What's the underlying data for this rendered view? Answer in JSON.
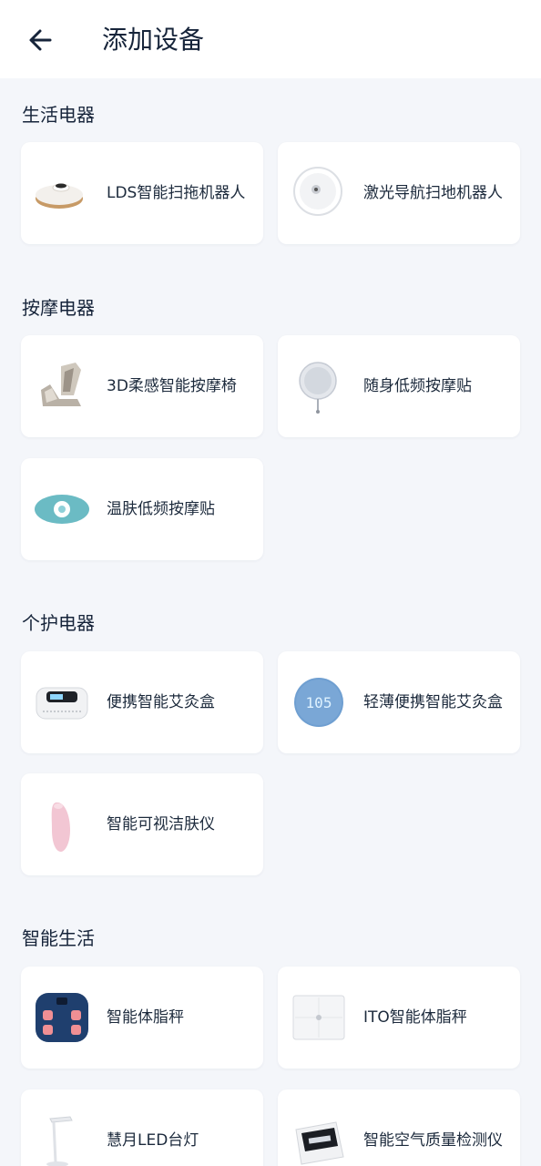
{
  "header": {
    "title": "添加设备",
    "back_icon": "arrow-left-icon"
  },
  "sections": [
    {
      "title": "生活电器",
      "devices": [
        {
          "label": "LDS智能扫拖机器人",
          "icon": "robot-vacuum-icon"
        },
        {
          "label": "激光导航扫地机器人",
          "icon": "robot-vacuum-white-icon"
        }
      ]
    },
    {
      "title": "按摩电器",
      "devices": [
        {
          "label": "3D柔感智能按摩椅",
          "icon": "massage-chair-icon"
        },
        {
          "label": "随身低频按摩贴",
          "icon": "massage-pad-round-icon"
        },
        {
          "label": "温肤低频按摩贴",
          "icon": "massage-pad-oval-icon"
        }
      ]
    },
    {
      "title": "个护电器",
      "devices": [
        {
          "label": "便携智能艾灸盒",
          "icon": "moxibustion-box-icon"
        },
        {
          "label": "轻薄便携智能艾灸盒",
          "icon": "moxibustion-round-icon",
          "display": "105"
        },
        {
          "label": "智能可视洁肤仪",
          "icon": "skin-cleanser-icon"
        }
      ]
    },
    {
      "title": "智能生活",
      "devices": [
        {
          "label": "智能体脂秤",
          "icon": "body-fat-scale-blue-icon"
        },
        {
          "label": "ITO智能体脂秤",
          "icon": "body-fat-scale-white-icon"
        },
        {
          "label": "慧月LED台灯",
          "icon": "desk-lamp-icon"
        },
        {
          "label": "智能空气质量检测仪",
          "icon": "air-quality-monitor-icon"
        }
      ]
    }
  ]
}
